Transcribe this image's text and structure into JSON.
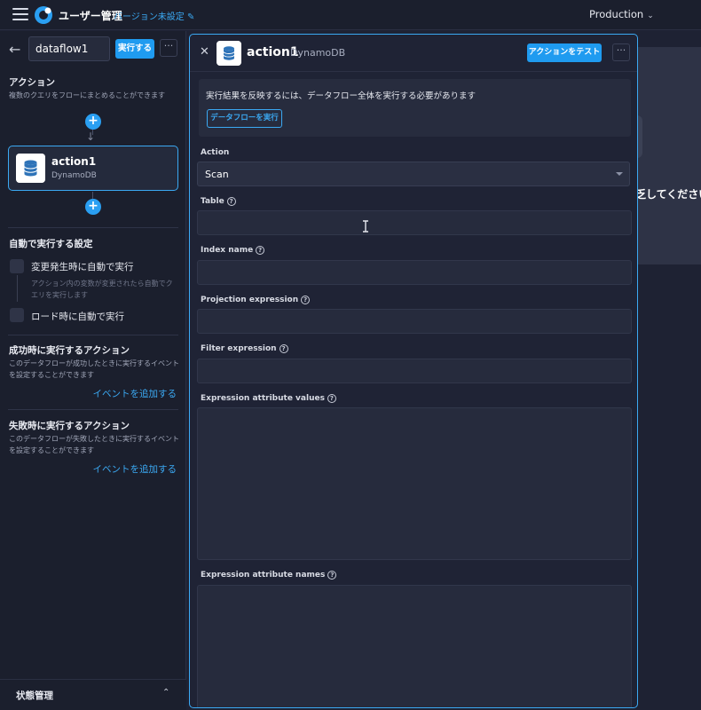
{
  "topbar": {
    "app_title": "ユーザー管理",
    "version_link": "バージョン未設定",
    "environment": "Production"
  },
  "sidebar": {
    "dataflow_name": "dataflow1",
    "run_label": "実行する",
    "more_label": "···",
    "actions_section": {
      "title": "アクション",
      "description": "複数のクエリをフローにまとめることができます"
    },
    "action_card": {
      "name": "action1",
      "type": "DynamoDB"
    },
    "auto_run": {
      "title": "自動で実行する設定",
      "on_change_label": "変更発生時に自動で実行",
      "on_change_hint": "アクション内の変数が変更されたら自動でクエリを実行します",
      "on_load_label": "ロード時に自動で実行"
    },
    "success_section": {
      "title": "成功時に実行するアクション",
      "description": "このデータフローが成功したときに実行するイベントを設定することができます",
      "add_event": "イベントを追加する"
    },
    "failure_section": {
      "title": "失敗時に実行するアクション",
      "description": "このデータフローが失敗したときに実行するイベントを設定することができます",
      "add_event": "イベントを追加する"
    },
    "footer_title": "状態管理"
  },
  "background": {
    "partial_text": "乏してください"
  },
  "panel": {
    "title": "action1",
    "subtitle": "DynamoDB",
    "test_button": "アクションをテスト",
    "more_label": "···",
    "notice": {
      "text": "実行結果を反映するには、データフロー全体を実行する必要があります",
      "button": "データフローを実行"
    },
    "fields": {
      "action_label": "Action",
      "action_value": "Scan",
      "table_label": "Table",
      "index_name_label": "Index name",
      "projection_label": "Projection expression",
      "filter_label": "Filter expression",
      "attr_values_label": "Expression attribute values",
      "attr_names_label": "Expression attribute names"
    }
  },
  "colors": {
    "accent": "#3ba9f3",
    "button": "#1f9bf0",
    "background": "#1e2233"
  }
}
